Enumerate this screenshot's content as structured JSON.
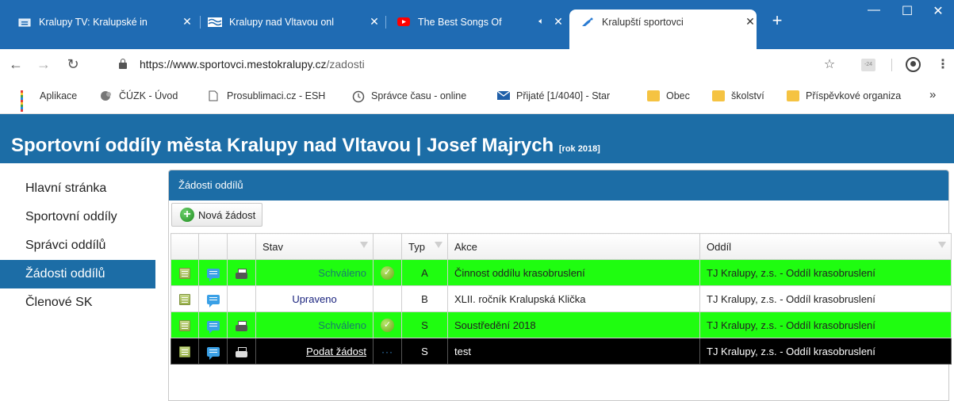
{
  "browser": {
    "tabs": [
      {
        "title": "Kralupy TV: Kralupské in",
        "active": false
      },
      {
        "title": "Kralupy nad Vltavou onl",
        "active": false
      },
      {
        "title": "The Best Songs Of",
        "active": false
      },
      {
        "title": "Kralupští sportovci",
        "active": true
      }
    ],
    "url_host": "https://www.sportovci.mestokralupy.cz",
    "url_path": "/zadosti",
    "ext_badge": "-24",
    "bookmarks": [
      {
        "label": "Aplikace",
        "icon": "apps-icon"
      },
      {
        "label": "ČÚZK - Úvod",
        "icon": "cuzk-icon"
      },
      {
        "label": "Prosublimaci.cz - ESH",
        "icon": "page-icon"
      },
      {
        "label": "Správce času - online",
        "icon": "clock-icon"
      },
      {
        "label": "Přijaté [1/4040] - Star",
        "icon": "mail-icon"
      },
      {
        "label": "Obec",
        "icon": "folder-icon"
      },
      {
        "label": "školství",
        "icon": "folder-icon"
      },
      {
        "label": "Příspěvkové organiza",
        "icon": "folder-icon"
      }
    ],
    "overflow": "»"
  },
  "site": {
    "title": "Sportovní oddíly města Kralupy nad Vltavou | Josef Majrych",
    "year": "[rok 2018]",
    "accent": "#1c6da6"
  },
  "sidebar": {
    "items": [
      {
        "label": "Hlavní stránka",
        "active": false
      },
      {
        "label": "Sportovní oddíly",
        "active": false
      },
      {
        "label": "Správci oddílů",
        "active": false
      },
      {
        "label": "Žádosti oddílů",
        "active": true
      },
      {
        "label": "Členové SK",
        "active": false
      }
    ]
  },
  "panel": {
    "title": "Žádosti oddílů",
    "new_button": "Nová žádost",
    "columns": {
      "state": "Stav",
      "type": "Typ",
      "action": "Akce",
      "club": "Oddíl"
    },
    "rows": [
      {
        "style": "green",
        "print": true,
        "state": "Schváleno",
        "mark": "check",
        "type": "A",
        "action": "Činnost oddílu krasobruslení",
        "club": "TJ Kralupy, z.s. - Oddíl krasobruslení"
      },
      {
        "style": "white",
        "print": false,
        "state": "Upraveno",
        "mark": "",
        "type": "B",
        "action": "XLII. ročník Kralupská Klička",
        "club": "TJ Kralupy, z.s. - Oddíl krasobruslení"
      },
      {
        "style": "green",
        "print": true,
        "state": "Schváleno",
        "mark": "check",
        "type": "S",
        "action": "Soustředění 2018",
        "club": "TJ Kralupy, z.s. - Oddíl krasobruslení"
      },
      {
        "style": "black",
        "print": true,
        "state": "Podat žádost",
        "mark": "dots",
        "type": "S",
        "action": "test",
        "club": "TJ Kralupy, z.s. - Oddíl krasobruslení"
      }
    ]
  }
}
